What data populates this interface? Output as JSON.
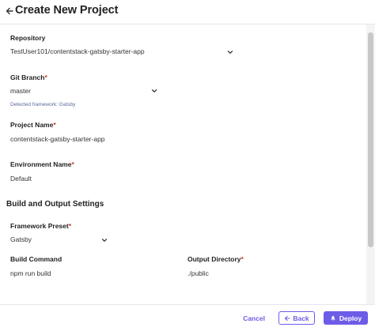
{
  "header": {
    "title": "Create New Project"
  },
  "form": {
    "repository": {
      "label": "Repository",
      "value": "TestUser101/contentstack-gatsby-starter-app"
    },
    "git_branch": {
      "label": "Git Branch",
      "required_mark": "*",
      "value": "master",
      "hint": "Detected framework: Gatsby"
    },
    "project_name": {
      "label": "Project Name",
      "required_mark": "*",
      "value": "contentstack-gatsby-starter-app"
    },
    "environment_name": {
      "label": "Environment Name",
      "required_mark": "*",
      "value": "Default"
    },
    "build_section": {
      "title": "Build and Output Settings"
    },
    "framework_preset": {
      "label": "Framework Preset",
      "required_mark": "*",
      "value": "Gatsby"
    },
    "build_command": {
      "label": "Build Command",
      "value": "npm run build"
    },
    "output_directory": {
      "label": "Output Directory",
      "required_mark": "*",
      "value": "./public"
    }
  },
  "footer": {
    "cancel_label": "Cancel",
    "back_label": "Back",
    "deploy_label": "Deploy"
  },
  "icons": {
    "back": "arrow-left-icon",
    "dropdown": "chevron-down-icon",
    "deploy": "rocket-icon"
  },
  "colors": {
    "accent": "#6c5ce7",
    "required": "#c0392b",
    "hint": "#5a6b9a"
  }
}
